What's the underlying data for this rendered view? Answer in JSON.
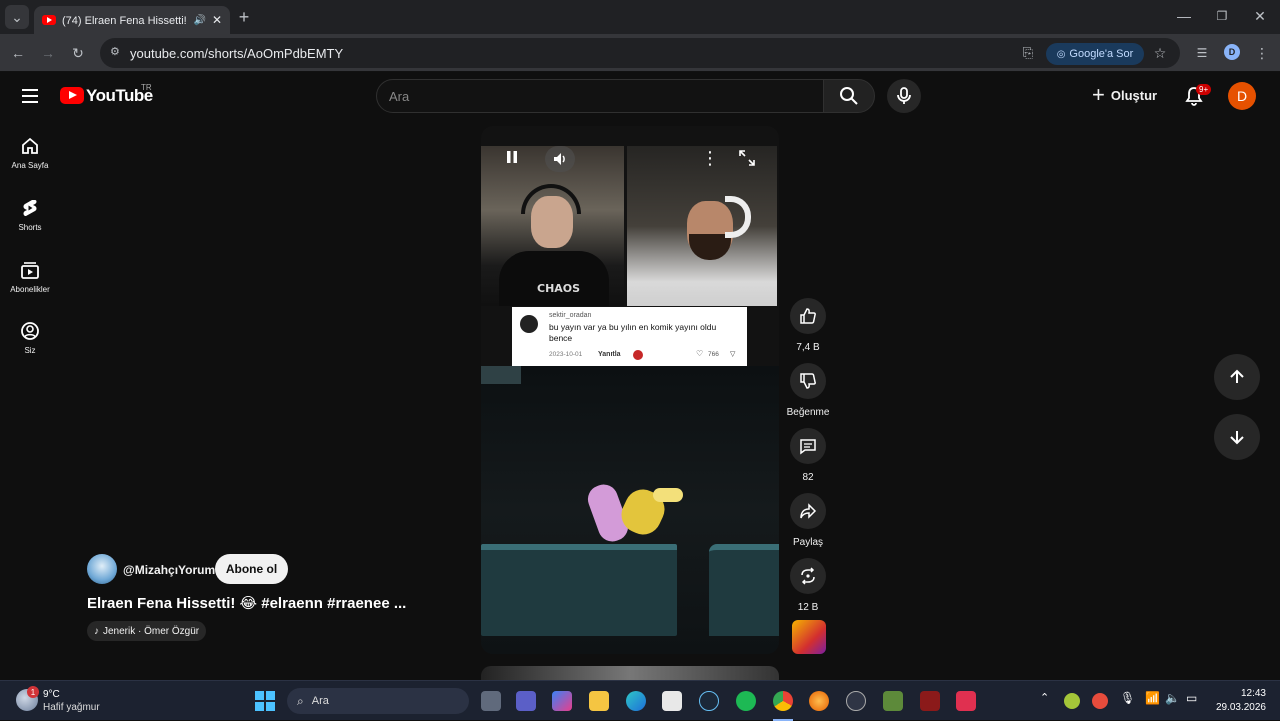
{
  "browser": {
    "tab_title": "(74) Elraen Fena Hissetti! 😂",
    "url": "youtube.com/shorts/AoOmPdbEMTY",
    "google_sor": "Google'a Sor",
    "profile_initial": "D"
  },
  "header": {
    "logo_text": "YouTube",
    "country_code": "TR",
    "search_placeholder": "Ara",
    "create_label": "Oluştur",
    "notif_badge": "9+",
    "avatar_initial": "D"
  },
  "sidebar": {
    "items": [
      {
        "label": "Ana Sayfa",
        "icon": "home-icon"
      },
      {
        "label": "Shorts",
        "icon": "shorts-icon"
      },
      {
        "label": "Abonelikler",
        "icon": "subscriptions-icon"
      },
      {
        "label": "Siz",
        "icon": "you-icon"
      }
    ]
  },
  "video": {
    "overlay_label": "CHAOS",
    "comment": {
      "user": "sektir_oradan",
      "text": "bu yayın var ya bu yılın en komik yayını oldu bence",
      "date": "2023-10-01",
      "reply": "Yanıtla",
      "likes": "766"
    }
  },
  "actions": {
    "like_count": "7,4 B",
    "dislike_label": "Beğenme",
    "comments_count": "82",
    "share_label": "Paylaş",
    "remix_count": "12 B"
  },
  "channel": {
    "handle": "@MizahçıYorum",
    "subscribe_label": "Abone ol",
    "title": "Elraen Fena Hissetti! 😂 #elraenn #rraenee ...",
    "music": "Jenerik · Ömer Özgür"
  },
  "taskbar": {
    "weather_temp": "9°C",
    "weather_desc": "Hafif yağmur",
    "weather_badge": "1",
    "search_placeholder": "Ara",
    "time": "12:43",
    "date": "29.03.2026"
  }
}
